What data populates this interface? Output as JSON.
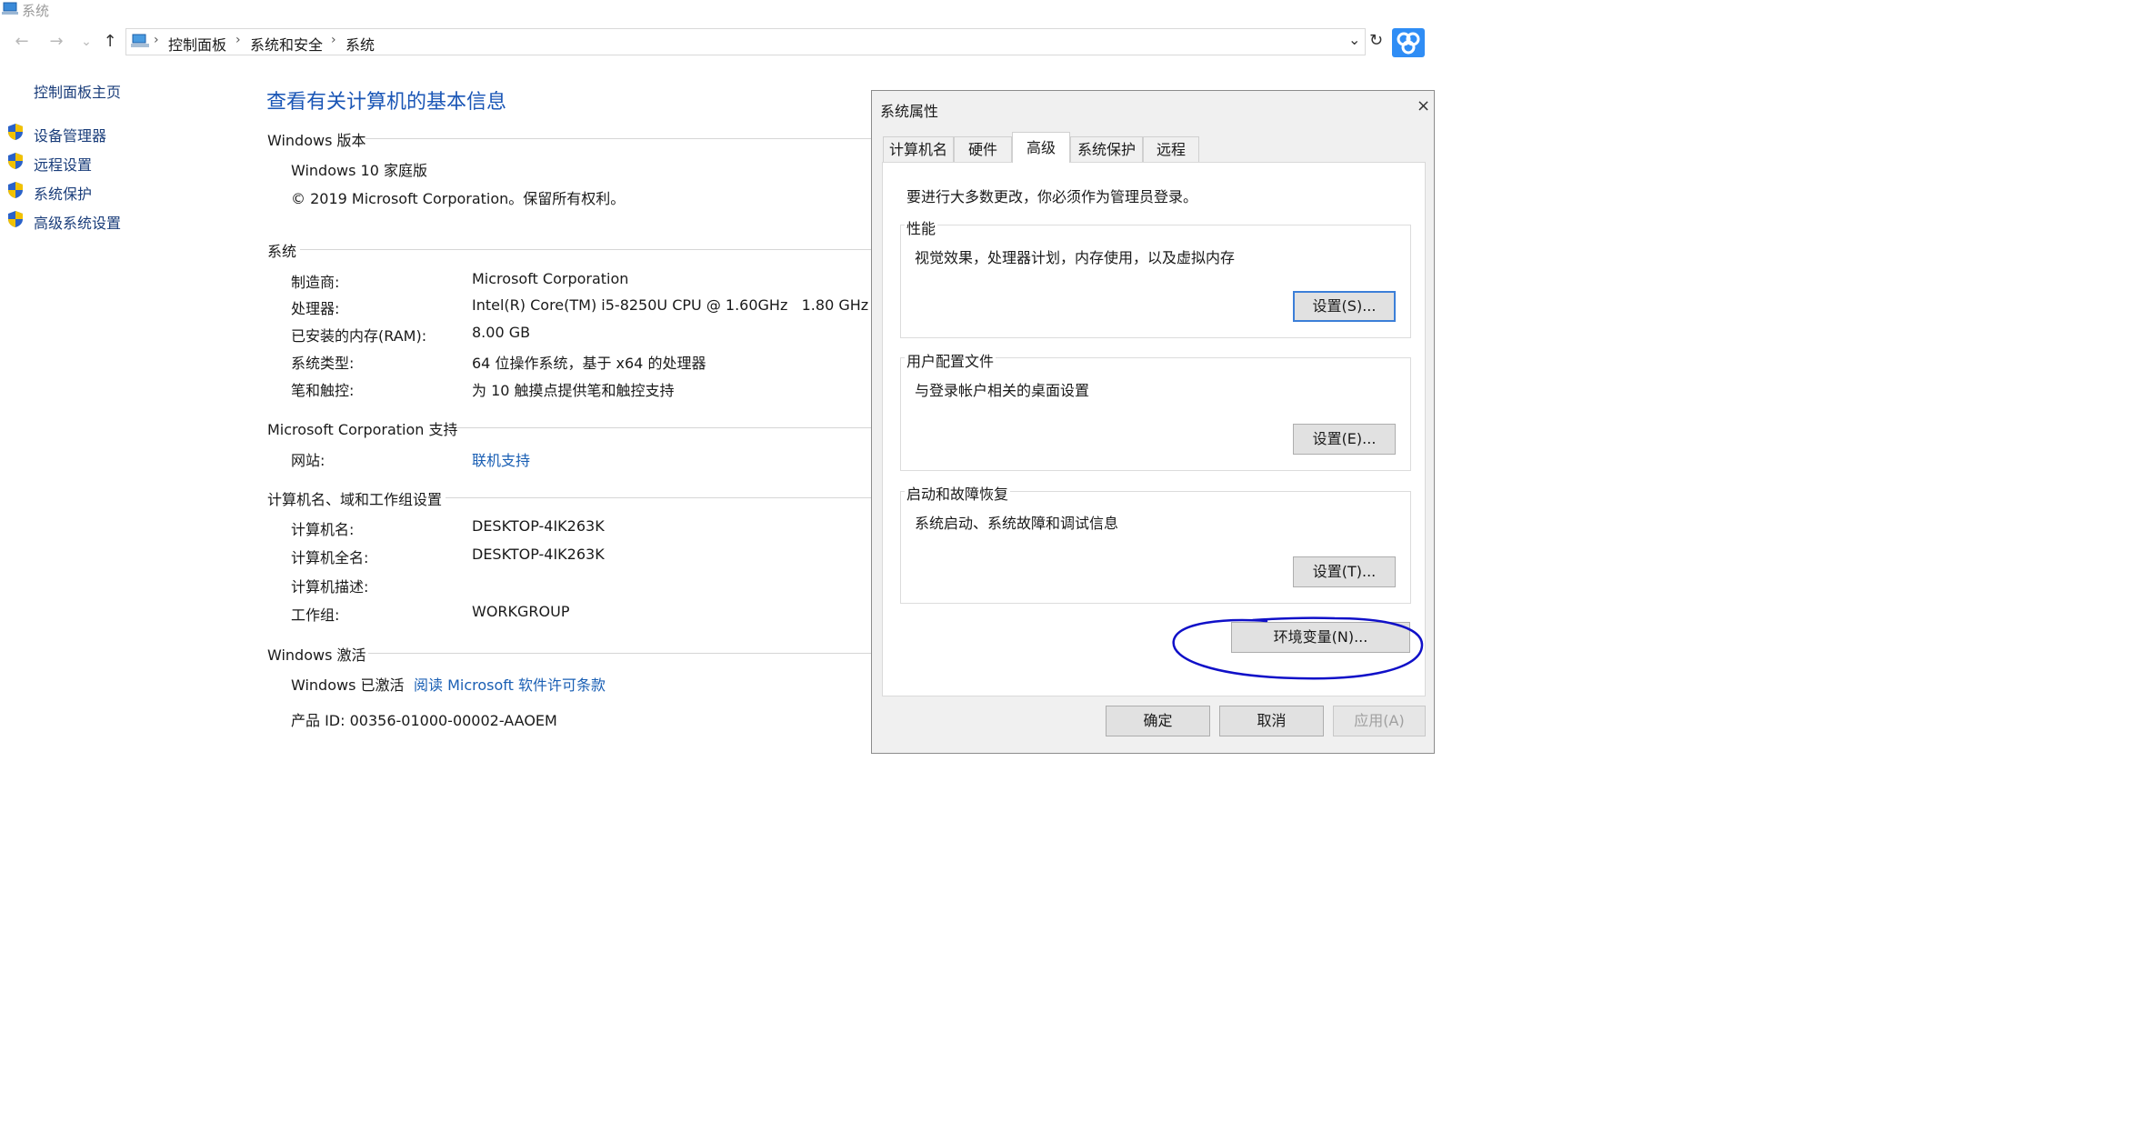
{
  "window": {
    "title": "系统"
  },
  "breadcrumb": [
    "控制面板",
    "系统和安全",
    "系统"
  ],
  "nav": {
    "back": "←",
    "forward": "→",
    "down": "⌄",
    "up": "↑",
    "dropdown": "⌄",
    "refresh": "↻"
  },
  "sidebar": {
    "home": "控制面板主页",
    "items": [
      {
        "label": "设备管理器",
        "icon": "shield-icon"
      },
      {
        "label": "远程设置",
        "icon": "shield-icon"
      },
      {
        "label": "系统保护",
        "icon": "shield-icon"
      },
      {
        "label": "高级系统设置",
        "icon": "shield-icon"
      }
    ]
  },
  "main": {
    "title": "查看有关计算机的基本信息",
    "windows_edition": {
      "heading": "Windows 版本",
      "edition": "Windows 10 家庭版",
      "copyright": "© 2019 Microsoft Corporation。保留所有权利。"
    },
    "system": {
      "heading": "系统",
      "rows": [
        {
          "label": "制造商:",
          "value": "Microsoft Corporation"
        },
        {
          "label": "处理器:",
          "value": "Intel(R) Core(TM) i5-8250U CPU @ 1.60GHz   1.80 GHz"
        },
        {
          "label": "已安装的内存(RAM):",
          "value": "8.00 GB"
        },
        {
          "label": "系统类型:",
          "value": "64 位操作系统，基于 x64 的处理器"
        },
        {
          "label": "笔和触控:",
          "value": "为 10 触摸点提供笔和触控支持"
        }
      ]
    },
    "support": {
      "heading": "Microsoft Corporation 支持",
      "label": "网站:",
      "link": "联机支持"
    },
    "computer_name": {
      "heading": "计算机名、域和工作组设置",
      "rows": [
        {
          "label": "计算机名:",
          "value": "DESKTOP-4IK263K"
        },
        {
          "label": "计算机全名:",
          "value": "DESKTOP-4IK263K"
        },
        {
          "label": "计算机描述:",
          "value": ""
        },
        {
          "label": "工作组:",
          "value": "WORKGROUP"
        }
      ]
    },
    "activation": {
      "heading": "Windows 激活",
      "status": "Windows 已激活",
      "link": "阅读 Microsoft 软件许可条款",
      "product_id": "产品 ID: 00356-01000-00002-AAOEM"
    }
  },
  "dialog": {
    "title": "系统属性",
    "close": "×",
    "tabs": [
      "计算机名",
      "硬件",
      "高级",
      "系统保护",
      "远程"
    ],
    "active_tab": "高级",
    "admin_note": "要进行大多数更改，你必须作为管理员登录。",
    "groups": [
      {
        "title": "性能",
        "desc": "视觉效果，处理器计划，内存使用，以及虚拟内存",
        "button": "设置(S)..."
      },
      {
        "title": "用户配置文件",
        "desc": "与登录帐户相关的桌面设置",
        "button": "设置(E)..."
      },
      {
        "title": "启动和故障恢复",
        "desc": "系统启动、系统故障和调试信息",
        "button": "设置(T)..."
      }
    ],
    "env_button": "环境变量(N)...",
    "ok": "确定",
    "cancel": "取消",
    "apply": "应用(A)"
  },
  "colors": {
    "link": "#1a5fb4",
    "title_blue": "#1a56b6",
    "annotation": "#1010c8",
    "baidu": "#2f8df5"
  }
}
